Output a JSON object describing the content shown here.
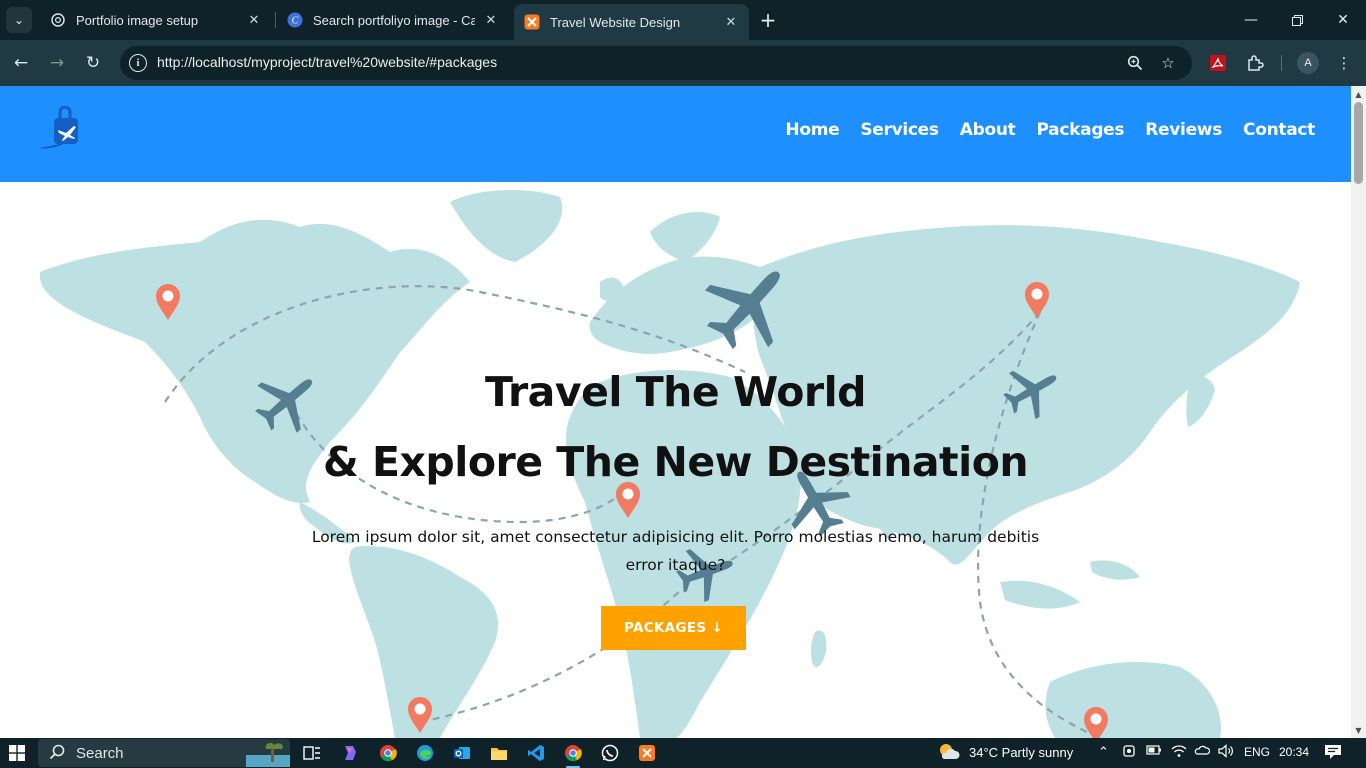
{
  "browser": {
    "tabs": [
      {
        "title": "Portfolio image setup",
        "icon": "chatgpt-icon",
        "active": false
      },
      {
        "title": "Search portfoliyo image - Canva",
        "icon": "canva-icon",
        "active": false
      },
      {
        "title": "Travel Website Design",
        "icon": "xampp-icon",
        "active": true
      }
    ],
    "url": "http://localhost/myproject/travel%20website/#packages",
    "profile_initial": "A"
  },
  "site": {
    "nav": [
      "Home",
      "Services",
      "About",
      "Packages",
      "Reviews",
      "Contact"
    ],
    "hero": {
      "title_line1": "Travel The World",
      "title_line2": "& Explore The New Destination",
      "description": "Lorem ipsum dolor sit, amet consectetur adipisicing elit. Porro molestias nemo, harum debitis error itaque?",
      "button_label": "PACKAGES ↓"
    },
    "colors": {
      "header": "#1e8fff",
      "button": "#ffa200",
      "map": "#b4dde0",
      "pin": "#f0684a",
      "plane": "#3f6d82"
    }
  },
  "taskbar": {
    "search_label": "Search",
    "weather": "34°C  Partly sunny",
    "language": "ENG",
    "time": "20:34"
  }
}
